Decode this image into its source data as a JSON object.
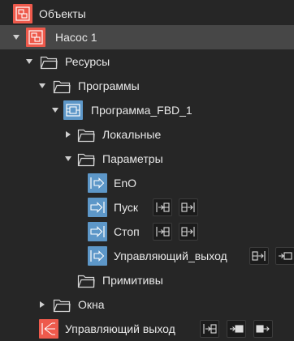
{
  "tree": {
    "objects": {
      "label": "Объекты",
      "icon": "objects-tree-icon"
    },
    "pump": {
      "label": "Насос 1",
      "icon": "object-icon"
    },
    "resources": {
      "label": "Ресурсы",
      "icon": "folder-icon"
    },
    "programs": {
      "label": "Программы",
      "icon": "folder-icon"
    },
    "program_fbd": {
      "label": "Программа_FBD_1",
      "icon": "fbd-program-icon"
    },
    "local": {
      "label": "Локальные",
      "icon": "folder-icon"
    },
    "params": {
      "label": "Параметры",
      "icon": "folder-icon"
    },
    "param_eno": {
      "label": "EnO",
      "icon": "output-param-icon"
    },
    "param_start": {
      "label": "Пуск",
      "icon": "input-param-icon"
    },
    "param_stop": {
      "label": "Стоп",
      "icon": "input-param-icon"
    },
    "param_control": {
      "label": "Управляющий_выход",
      "icon": "output-param-icon"
    },
    "primitives": {
      "label": "Примитивы",
      "icon": "folder-icon"
    },
    "windows": {
      "label": "Окна",
      "icon": "folder-icon"
    },
    "control_output": {
      "label": "Управляющий выход",
      "icon": "signal-icon"
    }
  },
  "colors": {
    "background": "#262626",
    "selected_row": "#474747",
    "object_icon": "#ee5a4c",
    "param_icon": "#5d97c8",
    "text": "#e8e8e8"
  }
}
